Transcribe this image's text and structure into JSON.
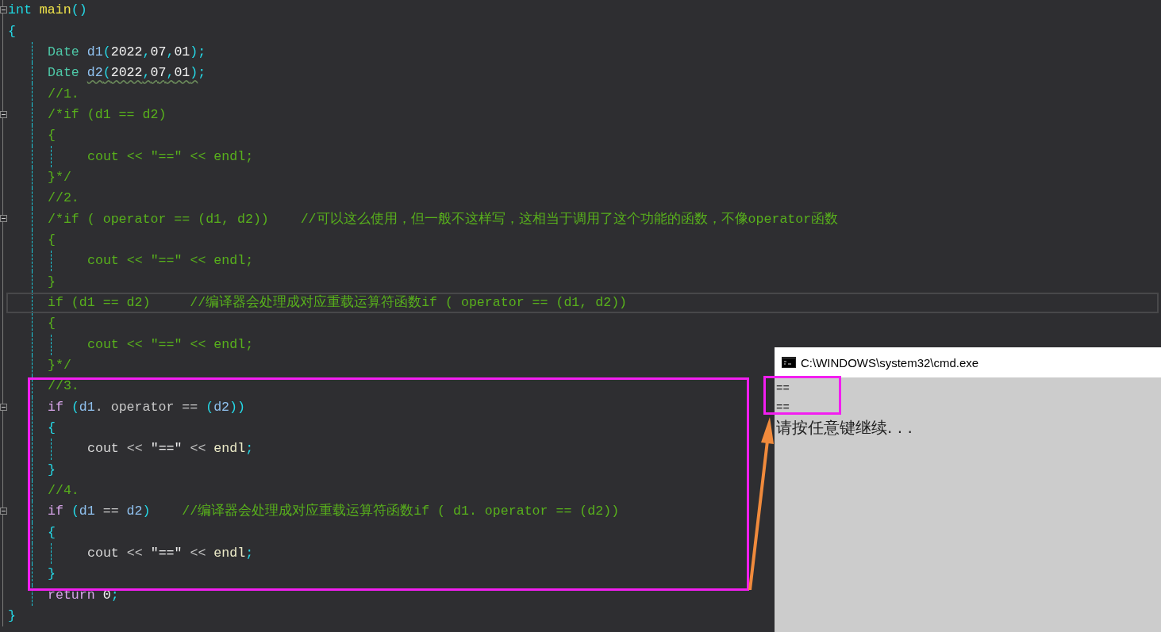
{
  "editor": {
    "lines": [
      {
        "fold": {
          "expanded": true
        },
        "tokens": [
          {
            "text": "int ",
            "kind": "keyword"
          },
          {
            "text": "main",
            "kind": "function"
          },
          {
            "text": "()",
            "kind": "punct"
          }
        ]
      },
      {
        "tokens": [
          {
            "text": "{",
            "kind": "punct"
          }
        ],
        "children": [
          {
            "tokens": [
              {
                "text": "Date ",
                "kind": "type"
              },
              {
                "text": "d1",
                "kind": "ident"
              },
              {
                "text": "(",
                "kind": "punct"
              },
              {
                "text": "2022",
                "kind": "number"
              },
              {
                "text": ",",
                "kind": "punct"
              },
              {
                "text": "07",
                "kind": "number"
              },
              {
                "text": ",",
                "kind": "punct"
              },
              {
                "text": "01",
                "kind": "number"
              },
              {
                "text": ")",
                "kind": "punct"
              },
              {
                "text": ";",
                "kind": "punct"
              }
            ]
          },
          {
            "tokens": [
              {
                "text": "Date ",
                "kind": "type"
              },
              {
                "text": "d2",
                "kind": "ident",
                "squiggle": true
              },
              {
                "text": "(",
                "kind": "punct",
                "squiggle": true
              },
              {
                "text": "2022",
                "kind": "number",
                "squiggle": true
              },
              {
                "text": ",",
                "kind": "punct",
                "squiggle": true
              },
              {
                "text": "07",
                "kind": "number",
                "squiggle": true
              },
              {
                "text": ",",
                "kind": "punct",
                "squiggle": true
              },
              {
                "text": "01",
                "kind": "number",
                "squiggle": true
              },
              {
                "text": ")",
                "kind": "punct",
                "squiggle": true
              },
              {
                "text": ";",
                "kind": "punct"
              }
            ]
          },
          {
            "tokens": [
              {
                "text": "//1.",
                "kind": "comment"
              }
            ]
          },
          {
            "fold": {
              "expanded": true
            },
            "tokens": [
              {
                "text": "/*if (d1 == d2)",
                "kind": "comment"
              }
            ]
          },
          {
            "tokens": [
              {
                "text": "{",
                "kind": "comment"
              }
            ],
            "children": [
              {
                "tokens": [
                  {
                    "text": "cout << \"==\" << endl;",
                    "kind": "comment"
                  }
                ]
              }
            ]
          },
          {
            "tokens": [
              {
                "text": "}*/",
                "kind": "comment"
              }
            ]
          },
          {
            "tokens": [
              {
                "text": "//2.",
                "kind": "comment"
              }
            ]
          },
          {
            "fold": {
              "expanded": true
            },
            "tokens": [
              {
                "text": "/*if ( operator == (d1, d2))    //可以这么使用，但一般不这样写，这相当于调用了这个功能的函数，不像operator函数",
                "kind": "comment"
              }
            ]
          },
          {
            "tokens": [
              {
                "text": "{",
                "kind": "comment"
              }
            ],
            "children": [
              {
                "tokens": [
                  {
                    "text": "cout << \"==\" << endl;",
                    "kind": "comment"
                  }
                ]
              }
            ]
          },
          {
            "tokens": [
              {
                "text": "}",
                "kind": "comment"
              }
            ]
          },
          {
            "current": true,
            "tokens": [
              {
                "text": "if (d1 == d2)     //编译器会处理成对应重载运算符函数if ( operator == (d1, d2))",
                "kind": "comment"
              }
            ]
          },
          {
            "tokens": [
              {
                "text": "{",
                "kind": "comment"
              }
            ],
            "children": [
              {
                "tokens": [
                  {
                    "text": "cout << \"==\" << endl;",
                    "kind": "comment"
                  }
                ]
              }
            ]
          },
          {
            "tokens": [
              {
                "text": "}*/",
                "kind": "comment"
              }
            ]
          },
          {
            "tokens": [
              {
                "text": "//3.",
                "kind": "comment"
              }
            ]
          },
          {
            "fold": {
              "expanded": true
            },
            "tokens": [
              {
                "text": "if ",
                "kind": "control"
              },
              {
                "text": "(",
                "kind": "punct"
              },
              {
                "text": "d1",
                "kind": "ident"
              },
              {
                "text": ". ",
                "kind": "plain"
              },
              {
                "text": "operator == ",
                "kind": "operator"
              },
              {
                "text": "(",
                "kind": "punct"
              },
              {
                "text": "d2",
                "kind": "ident"
              },
              {
                "text": "))",
                "kind": "punct"
              }
            ]
          },
          {
            "tokens": [
              {
                "text": "{",
                "kind": "punct"
              }
            ],
            "children": [
              {
                "tokens": [
                  {
                    "text": "cout ",
                    "kind": "stream"
                  },
                  {
                    "text": "<< ",
                    "kind": "operator"
                  },
                  {
                    "text": "\"==\" ",
                    "kind": "string"
                  },
                  {
                    "text": "<< ",
                    "kind": "operator"
                  },
                  {
                    "text": "endl",
                    "kind": "manip"
                  },
                  {
                    "text": ";",
                    "kind": "punct"
                  }
                ]
              }
            ]
          },
          {
            "tokens": [
              {
                "text": "}",
                "kind": "punct"
              }
            ]
          },
          {
            "tokens": [
              {
                "text": "//4.",
                "kind": "comment"
              }
            ]
          },
          {
            "fold": {
              "expanded": true
            },
            "tokens": [
              {
                "text": "if ",
                "kind": "control"
              },
              {
                "text": "(",
                "kind": "punct"
              },
              {
                "text": "d1 ",
                "kind": "ident"
              },
              {
                "text": "== ",
                "kind": "operator"
              },
              {
                "text": "d2",
                "kind": "ident"
              },
              {
                "text": ")    ",
                "kind": "punct"
              },
              {
                "text": "//编译器会处理成对应重载运算符函数if ( d1. operator == (d2))",
                "kind": "comment"
              }
            ]
          },
          {
            "tokens": [
              {
                "text": "{",
                "kind": "punct"
              }
            ],
            "children": [
              {
                "tokens": [
                  {
                    "text": "cout ",
                    "kind": "stream"
                  },
                  {
                    "text": "<< ",
                    "kind": "operator"
                  },
                  {
                    "text": "\"==\" ",
                    "kind": "string"
                  },
                  {
                    "text": "<< ",
                    "kind": "operator"
                  },
                  {
                    "text": "endl",
                    "kind": "manip"
                  },
                  {
                    "text": ";",
                    "kind": "punct"
                  }
                ]
              }
            ]
          },
          {
            "tokens": [
              {
                "text": "}",
                "kind": "punct"
              }
            ]
          },
          {
            "tokens": [
              {
                "text": "return ",
                "kind": "control"
              },
              {
                "text": "0",
                "kind": "number"
              },
              {
                "text": ";",
                "kind": "punct"
              }
            ]
          }
        ]
      },
      {
        "tokens": [
          {
            "text": "}",
            "kind": "punct"
          }
        ]
      }
    ]
  },
  "console": {
    "title": "C:\\WINDOWS\\system32\\cmd.exe",
    "output": [
      "==",
      "=="
    ],
    "prompt": "请按任意键继续. . ."
  }
}
